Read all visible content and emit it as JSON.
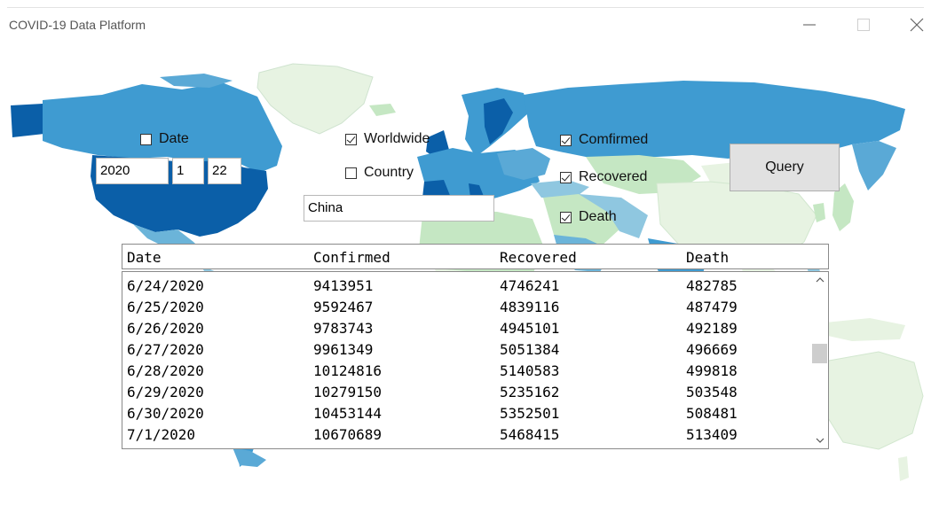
{
  "window": {
    "title": "COVID-19 Data Platform"
  },
  "controls": {
    "date_checkbox": {
      "label": "Date",
      "checked": false
    },
    "year_value": "2020",
    "month_value": "1",
    "day_value": "22",
    "worldwide_checkbox": {
      "label": "Worldwide",
      "checked": true
    },
    "country_checkbox": {
      "label": "Country",
      "checked": false
    },
    "country_value": "China",
    "confirmed_checkbox": {
      "label": "Comfirmed",
      "checked": true
    },
    "recovered_checkbox": {
      "label": "Recovered",
      "checked": true
    },
    "death_checkbox": {
      "label": "Death",
      "checked": true
    },
    "query_label": "Query"
  },
  "table": {
    "columns": [
      "Date",
      "Confirmed",
      "Recovered",
      "Death"
    ],
    "rows": [
      [
        "6/24/2020",
        "9413951",
        "4746241",
        "482785"
      ],
      [
        "6/25/2020",
        "9592467",
        "4839116",
        "487479"
      ],
      [
        "6/26/2020",
        "9783743",
        "4945101",
        "492189"
      ],
      [
        "6/27/2020",
        "9961349",
        "5051384",
        "496669"
      ],
      [
        "6/28/2020",
        "10124816",
        "5140583",
        "499818"
      ],
      [
        "6/29/2020",
        "10279150",
        "5235162",
        "503548"
      ],
      [
        "6/30/2020",
        "10453144",
        "5352501",
        "508481"
      ],
      [
        "7/1/2020",
        "10670689",
        "5468415",
        "513409"
      ]
    ],
    "scroll_position": 0.45
  },
  "colors": {
    "map_dark": "#0b5fa8",
    "map_mid": "#3f9bd1",
    "map_light": "#8fc7e0",
    "map_green": "#c5e7c3",
    "map_pale": "#e7f3e2"
  }
}
